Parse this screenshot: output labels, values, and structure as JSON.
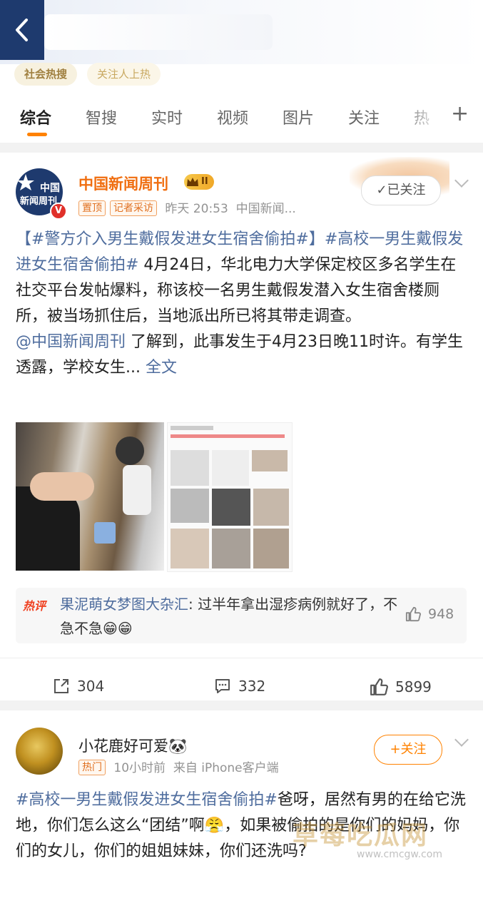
{
  "header": {
    "chips": [
      "社会热搜",
      "关注人上热"
    ],
    "tabs": [
      "综合",
      "智搜",
      "实时",
      "视频",
      "图片",
      "关注",
      "热"
    ],
    "active_tab": "综合",
    "plus_label": "+"
  },
  "post1": {
    "avatar_text": "中国\n新闻周刊",
    "author": "中国新闻周刊",
    "level_badge": "II",
    "tags": [
      "置顶",
      "记者采访"
    ],
    "time": "昨天 20:53",
    "source": "中国新闻...",
    "follow_label": "✓已关注",
    "text_hashtag1": "【#警方介入男生戴假发进女生宿舍偷拍#】",
    "text_hashtag2": "#高校一男生戴假发进女生宿舍偷拍#",
    "text_body": " 4月24日，华北电力大学保定校区多名学生在社交平台发帖爆料，称该校一名男生戴假发潜入女生宿舍楼厕所，被当场抓住后，当地派出所已将其带走调查。",
    "mention": "@中国新闻周刊",
    "text_body2": " 了解到，此事发生于4月23日晚11时许。有学生透露，学校女生... ",
    "full_text_link": "全文",
    "hot_comment": {
      "label": "热评",
      "user": "果泥萌女梦图大杂汇",
      "text": ": 过半年拿出湿疹病例就好了，不急不急",
      "emoji": "😁😁",
      "likes": "948"
    },
    "actions": {
      "reposts": "304",
      "comments": "332",
      "likes": "5899"
    }
  },
  "post2": {
    "author": "小花鹿好可爱",
    "author_emoji": "🐼",
    "tag": "热门",
    "time": "10小时前",
    "source": "来自 iPhone客户端",
    "follow_label": "+关注",
    "hashtag": "#高校一男生戴假发进女生宿舍偷拍#",
    "text_body": "爸呀，居然有男的在给它洗地，你们怎么这么“团结”啊😤，如果被偷拍的是你们的妈妈，你们的女儿，你们的姐姐妹妹，你们还洗吗?"
  },
  "watermark": {
    "title": "草莓吃瓜网",
    "url": "www.cmcgw.com"
  },
  "colors": {
    "accent": "#ff8200",
    "link": "#4f6d9e",
    "brand_blue": "#1e3a6e"
  }
}
